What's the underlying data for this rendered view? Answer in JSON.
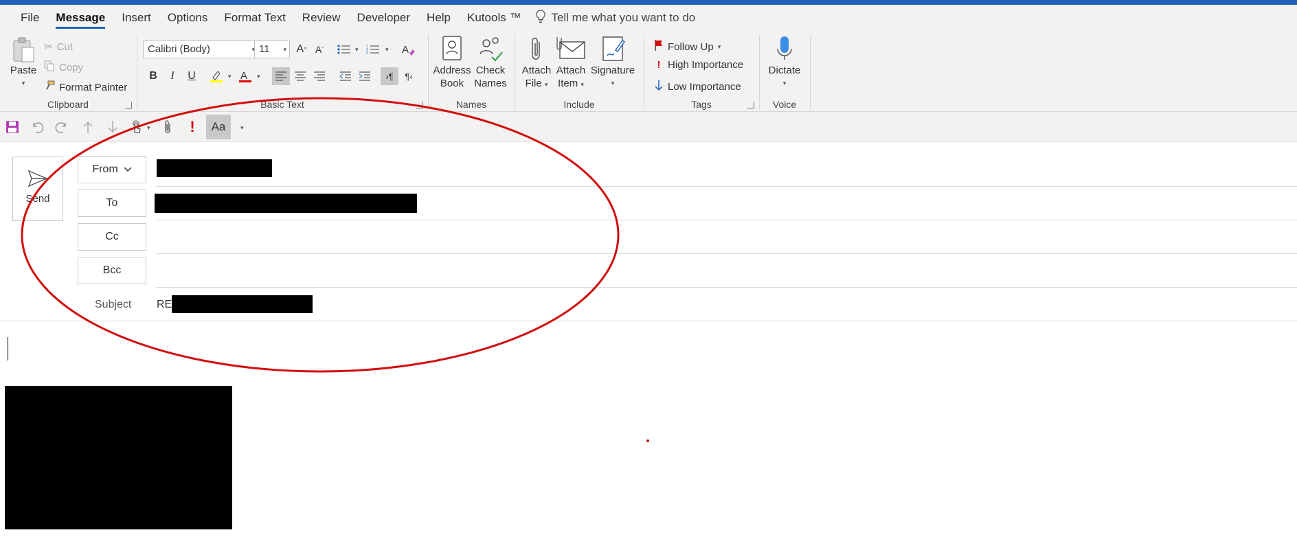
{
  "tabs": [
    {
      "label": "File"
    },
    {
      "label": "Message",
      "active": true
    },
    {
      "label": "Insert"
    },
    {
      "label": "Options"
    },
    {
      "label": "Format Text"
    },
    {
      "label": "Review"
    },
    {
      "label": "Developer"
    },
    {
      "label": "Help"
    },
    {
      "label": "Kutools ™"
    }
  ],
  "tell_me": "Tell me what you want to do",
  "clipboard": {
    "paste": "Paste",
    "cut": "Cut",
    "copy": "Copy",
    "format_painter": "Format Painter",
    "label": "Clipboard"
  },
  "basic_text": {
    "font": "Calibri (Body)",
    "size": "11",
    "label": "Basic Text"
  },
  "names": {
    "address_book_1": "Address",
    "address_book_2": "Book",
    "check_names_1": "Check",
    "check_names_2": "Names",
    "label": "Names"
  },
  "include": {
    "attach_file_1": "Attach",
    "attach_file_2": "File",
    "attach_item_1": "Attach",
    "attach_item_2": "Item",
    "signature": "Signature",
    "label": "Include"
  },
  "tags": {
    "follow_up": "Follow Up",
    "high_importance": "High Importance",
    "low_importance": "Low Importance",
    "label": "Tags"
  },
  "voice": {
    "dictate": "Dictate",
    "label": "Voice"
  },
  "qat": {
    "font_button": "Aa"
  },
  "compose": {
    "send": "Send",
    "from": "From",
    "to": "To",
    "cc": "Cc",
    "bcc": "Bcc",
    "subject_label": "Subject",
    "subject_prefix": "RE:"
  },
  "colors": {
    "accent": "#1f63b8",
    "annotation": "#d10f0f",
    "importance_high": "#d10f0f",
    "highlight": "#ffff00",
    "font_color": "#e00000"
  }
}
